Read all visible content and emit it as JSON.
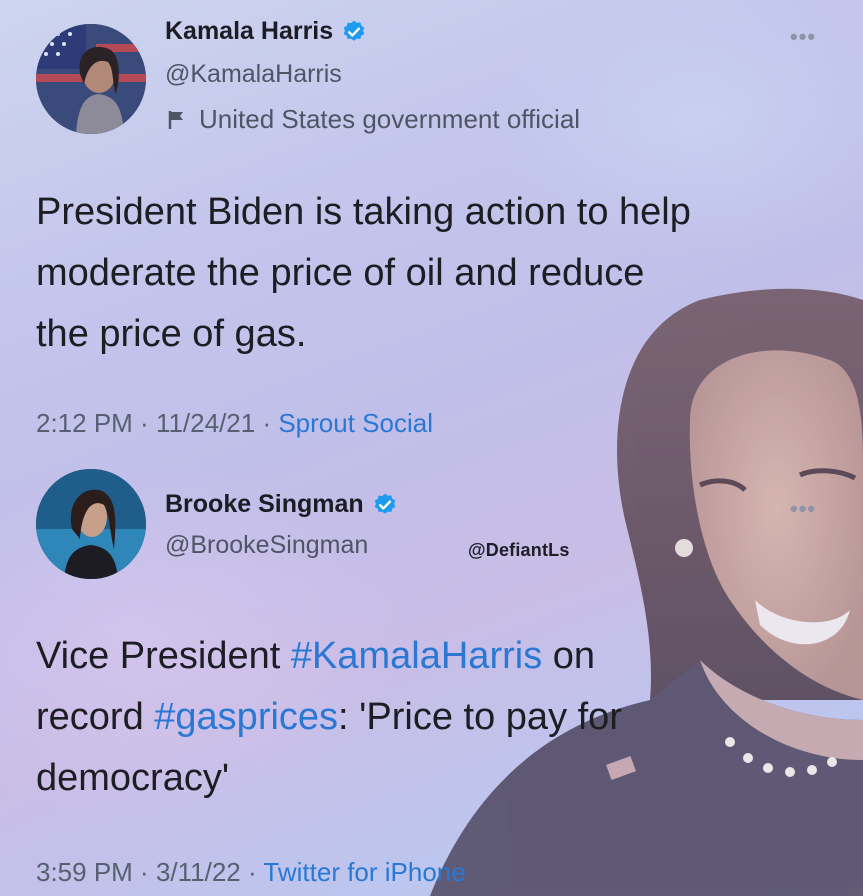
{
  "tweet1": {
    "name": "Kamala Harris",
    "handle": "@KamalaHarris",
    "label": "United States government official",
    "text": "President Biden is taking action to help\nmoderate the price of oil and reduce\nthe price of gas.",
    "time": "2:12 PM",
    "date": "11/24/21",
    "source": "Sprout Social",
    "separator": " · "
  },
  "tweet2": {
    "name": "Brooke Singman",
    "handle": "@BrookeSingman",
    "text_parts": [
      "Vice President ",
      "#KamalaHarris",
      " on\nrecord ",
      "#gasprices",
      ": 'Price to pay for\ndemocracy'"
    ],
    "time": "3:59 PM",
    "date": "3/11/22",
    "source": "Twitter for iPhone",
    "separator": " · "
  },
  "watermark": "@DefiantLs",
  "more_glyph": "•••",
  "colors": {
    "link": "#2a78d4",
    "verified": "#1d9bf0",
    "text": "#1d1d24",
    "muted": "#566070"
  },
  "icons": [
    "verified-badge-icon",
    "flag-icon",
    "more-icon"
  ]
}
